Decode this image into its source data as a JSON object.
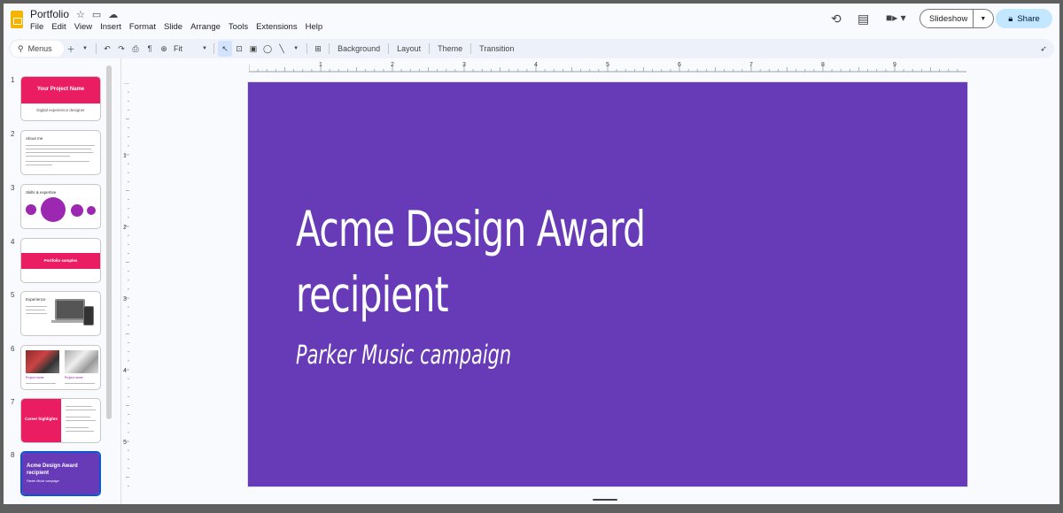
{
  "app": {
    "title": "Portfolio",
    "menu": [
      "File",
      "Edit",
      "View",
      "Insert",
      "Format",
      "Slide",
      "Arrange",
      "Tools",
      "Extensions",
      "Help"
    ],
    "slideshow_label": "Slideshow",
    "share_label": "Share"
  },
  "toolbar": {
    "menus_label": "Menus",
    "zoom_label": "Fit",
    "background_label": "Background",
    "layout_label": "Layout",
    "theme_label": "Theme",
    "transition_label": "Transition"
  },
  "ruler": {
    "h_ticks": [
      "1",
      "2",
      "3",
      "4",
      "5",
      "6",
      "7",
      "8",
      "9"
    ],
    "v_ticks": [
      "1",
      "2",
      "3",
      "4",
      "5"
    ]
  },
  "slides": [
    {
      "num": "1",
      "title": "Your Project Name",
      "subtitle": "Digital experience designer"
    },
    {
      "num": "2",
      "title": "About me"
    },
    {
      "num": "3",
      "title": "Skills & expertise"
    },
    {
      "num": "4",
      "title": "Portfolio samples"
    },
    {
      "num": "5",
      "title": "Experience"
    },
    {
      "num": "6",
      "caption1": "Project name",
      "caption2": "Project name"
    },
    {
      "num": "7",
      "title": "Career highlights"
    },
    {
      "num": "8",
      "title": "Acme Design Award recipient",
      "subtitle": "Parker Music campaign"
    }
  ],
  "current_slide": {
    "title_line1": "Acme Design Award",
    "title_line2": "recipient",
    "subtitle": "Parker Music campaign",
    "background": "#673ab7"
  },
  "colors": {
    "accent_pink": "#ea1d62",
    "accent_purple": "#9c27b0",
    "selection_blue": "#0b57d0",
    "share_blue": "#c2e7ff"
  }
}
